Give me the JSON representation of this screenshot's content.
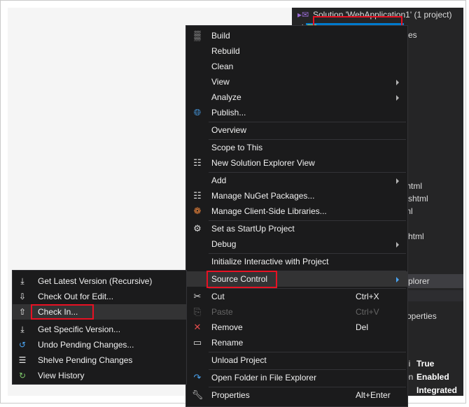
{
  "solution_explorer": {
    "header": "Solution 'WebApplication1' (1 project)",
    "project": "WebApplication1",
    "partials": [
      "ces",
      "thtml",
      "cshtml",
      "ml",
      "shtml"
    ],
    "explorer_tab": "plorer",
    "properties_tab": "roperties",
    "props": [
      {
        "name": "gi",
        "value": "True"
      },
      {
        "name": "on",
        "value": "Enabled"
      },
      {
        "name": "",
        "value": "Integrated"
      }
    ]
  },
  "context_menu": {
    "items": [
      {
        "label": "Build",
        "icon": "build-icon"
      },
      {
        "label": "Rebuild"
      },
      {
        "label": "Clean"
      },
      {
        "label": "View",
        "submenu": true
      },
      {
        "label": "Analyze",
        "submenu": true
      },
      {
        "label": "Publish...",
        "icon": "globe-icon"
      },
      {
        "label": "Overview"
      },
      {
        "label": "Scope to This"
      },
      {
        "label": "New Solution Explorer View",
        "icon": "new-view-icon"
      },
      {
        "label": "Add",
        "submenu": true
      },
      {
        "label": "Manage NuGet Packages...",
        "icon": "nuget-icon"
      },
      {
        "label": "Manage Client-Side Libraries...",
        "icon": "libraries-icon"
      },
      {
        "label": "Set as StartUp Project",
        "icon": "gear-icon"
      },
      {
        "label": "Debug",
        "submenu": true
      },
      {
        "label": "Initialize Interactive with Project"
      },
      {
        "label": "Source Control",
        "submenu": true
      },
      {
        "label": "Cut",
        "shortcut": "Ctrl+X",
        "icon": "scissors-icon"
      },
      {
        "label": "Paste",
        "shortcut": "Ctrl+V",
        "icon": "clipboard-icon",
        "disabled": true
      },
      {
        "label": "Remove",
        "shortcut": "Del",
        "icon": "x-icon"
      },
      {
        "label": "Rename",
        "icon": "rename-icon"
      },
      {
        "label": "Unload Project"
      },
      {
        "label": "Open Folder in File Explorer",
        "icon": "folder-arrow-icon"
      },
      {
        "label": "Properties",
        "shortcut": "Alt+Enter",
        "icon": "wrench-icon"
      }
    ]
  },
  "source_control_menu": {
    "items": [
      {
        "label": "Get Latest Version (Recursive)",
        "icon": "get-latest-icon"
      },
      {
        "label": "Check Out for Edit...",
        "icon": "checkout-icon"
      },
      {
        "label": "Check In...",
        "icon": "checkin-icon"
      },
      {
        "label": "Get Specific Version...",
        "icon": "get-specific-icon"
      },
      {
        "label": "Undo Pending Changes...",
        "icon": "undo-icon"
      },
      {
        "label": "Shelve Pending Changes",
        "icon": "shelve-icon"
      },
      {
        "label": "View History",
        "icon": "history-icon"
      }
    ]
  },
  "colors": {
    "menu_bg": "#1b1b1c",
    "selection": "#007acc",
    "highlight_box": "#e81123"
  }
}
